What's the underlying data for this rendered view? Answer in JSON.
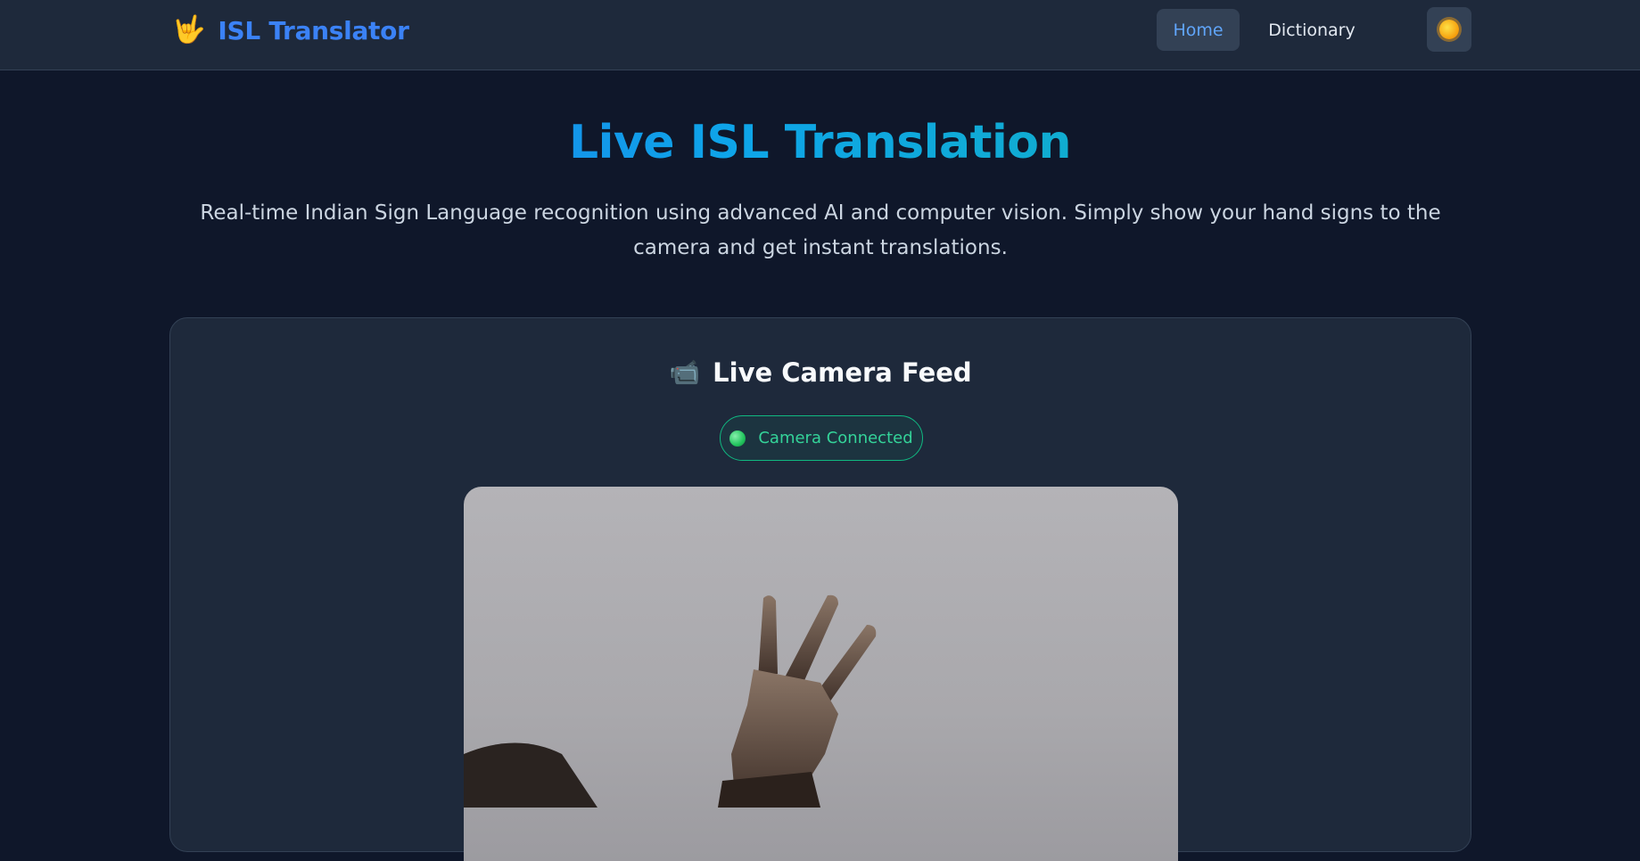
{
  "navbar": {
    "brand_icon": "🤟",
    "brand_title": "ISL Translator",
    "links": [
      {
        "label": "Home",
        "active": true
      },
      {
        "label": "Dictionary",
        "active": false
      }
    ],
    "theme_toggle_icon": "sun-icon"
  },
  "hero": {
    "title": "Live ISL Translation",
    "subtitle": "Real-time Indian Sign Language recognition using advanced AI and computer vision. Simply show your hand signs to the camera and get instant translations."
  },
  "camera_card": {
    "icon": "📹",
    "title": "Live Camera Feed",
    "status": "Camera Connected"
  },
  "colors": {
    "background": "#0f172a",
    "navbar": "#1e293b",
    "accent": "#3b82f6",
    "success": "#10b981"
  }
}
